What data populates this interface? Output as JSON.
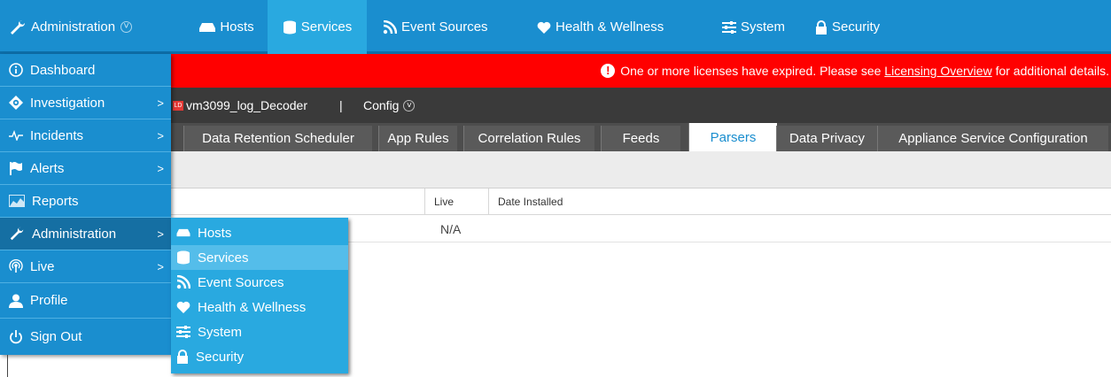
{
  "topnav": {
    "admin": "Administration",
    "items": [
      "Hosts",
      "Services",
      "Event Sources",
      "Health & Wellness",
      "System",
      "Security"
    ]
  },
  "banner": {
    "prefix": "One or more licenses have expired. Please see",
    "link": "Licensing Overview",
    "suffix": "for additional details."
  },
  "service_bar": {
    "badge": "LD",
    "name": "vm3099_log_Decoder",
    "separator": "|",
    "config": "Config"
  },
  "tabs": [
    "Data Retention Scheduler",
    "App Rules",
    "Correlation Rules",
    "Feeds",
    "Parsers",
    "Data Privacy",
    "Appliance Service Configuration"
  ],
  "table": {
    "headers": [
      "Live",
      "Date Installed"
    ],
    "rows": [
      [
        "N/A",
        ""
      ]
    ]
  },
  "leftnav": {
    "items": [
      "Dashboard",
      "Investigation",
      "Incidents",
      "Alerts",
      "Reports",
      "Administration",
      "Live",
      "Profile",
      "Sign Out"
    ]
  },
  "submenu": {
    "items": [
      "Hosts",
      "Services",
      "Event Sources",
      "Health & Wellness",
      "System",
      "Security"
    ]
  },
  "colors": {
    "nav_blue": "#1a8ecf",
    "active_blue": "#29a9e0",
    "alert_red": "#ff0000",
    "dark_bar": "#3a3a3a"
  }
}
